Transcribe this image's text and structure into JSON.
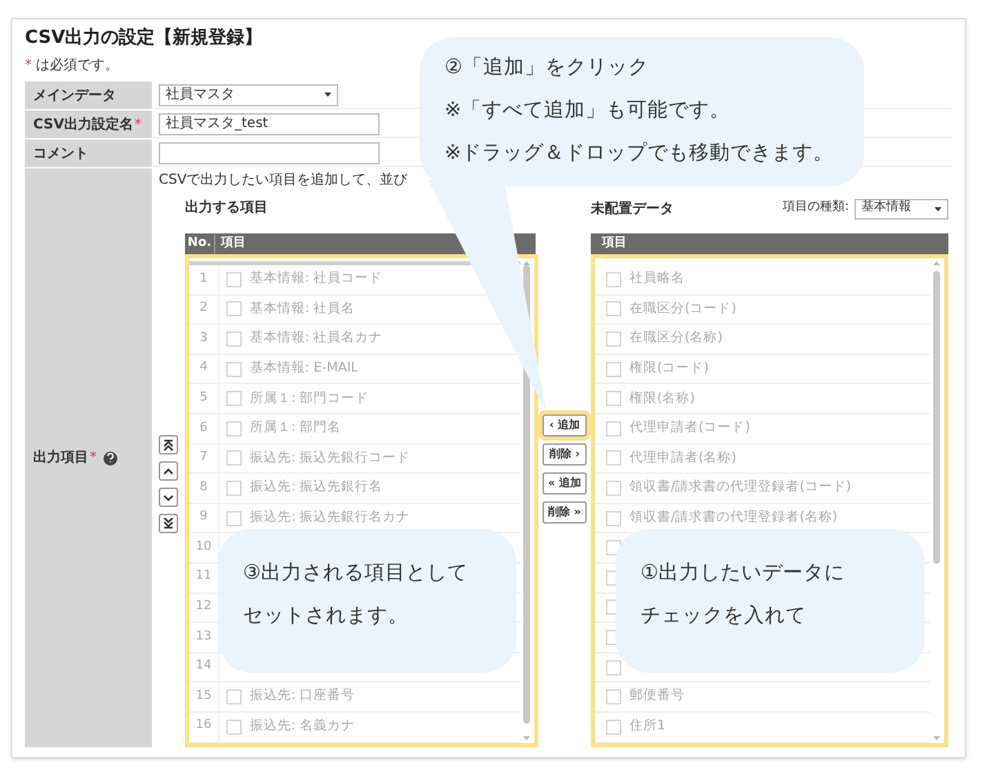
{
  "title": "CSV出力の設定【新規登録】",
  "required_note": {
    "mark": "*",
    "text": "は必須です。"
  },
  "form": [
    {
      "kind": "select",
      "label": "メインデータ",
      "value": "社員マスタ"
    },
    {
      "kind": "text",
      "label": "CSV出力設定名",
      "mark": "*",
      "value": "社員マスタ_test"
    },
    {
      "kind": "text",
      "label": "コメント"
    }
  ],
  "output_items": {
    "label": "出力項目",
    "mark": "*",
    "description": "CSVで出力したい項目を追加して、並び",
    "move_buttons": [
      {
        "kind": "top"
      },
      {
        "kind": "up"
      },
      {
        "kind": "down"
      },
      {
        "kind": "bottom"
      }
    ],
    "selected_list": {
      "title": "出力する項目",
      "columns": [
        "No.",
        "項目"
      ],
      "rows": [
        {
          "no": "1",
          "label": "基本情報: 社員コード",
          "checked": false
        },
        {
          "no": "2",
          "label": "基本情報: 社員名",
          "checked": false
        },
        {
          "no": "3",
          "label": "基本情報: 社員名カナ",
          "checked": false
        },
        {
          "no": "4",
          "label": "基本情報: E-MAIL",
          "checked": false
        },
        {
          "no": "5",
          "label": "所属１: 部門コード",
          "checked": false
        },
        {
          "no": "6",
          "label": "所属１: 部門名",
          "checked": false
        },
        {
          "no": "7",
          "label": "振込先: 振込先銀行コード",
          "checked": false
        },
        {
          "no": "8",
          "label": "振込先: 振込先銀行名",
          "checked": false
        },
        {
          "no": "9",
          "label": "振込先: 振込先銀行名カナ",
          "checked": false
        },
        {
          "no": "10"
        },
        {
          "no": "11"
        },
        {
          "no": "12"
        },
        {
          "no": "13"
        },
        {
          "no": "14"
        },
        {
          "no": "15",
          "label": "振込先: 口座番号",
          "checked": false
        },
        {
          "no": "16",
          "label": "振込先: 名義カナ",
          "checked": false
        }
      ]
    },
    "transfer_buttons": [
      {
        "label": "‹ 追加",
        "highlighted": true
      },
      {
        "label": "削除 ›",
        "highlighted": false
      },
      {
        "label": "« 追加",
        "highlighted": false
      },
      {
        "label": "削除 »",
        "highlighted": false
      }
    ],
    "available_list": {
      "title": "未配置データ",
      "filter_label": "項目の種類:",
      "filter_value": "基本情報",
      "columns": [
        "項目"
      ],
      "rows": [
        {
          "label": "社員略名",
          "checked": false
        },
        {
          "label": "在職区分(コード)",
          "checked": false
        },
        {
          "label": "在職区分(名称)",
          "checked": false
        },
        {
          "label": "権限(コード)",
          "checked": false
        },
        {
          "label": "権限(名称)",
          "checked": false
        },
        {
          "label": "代理申請者(コード)",
          "checked": false
        },
        {
          "label": "代理申請者(名称)",
          "checked": false
        },
        {
          "label": "領収書/請求書の代理登録者(コード)",
          "checked": false
        },
        {
          "label": "領収書/請求書の代理登録者(名称)",
          "checked": false
        },
        {
          "checked": false
        },
        {
          "checked": false
        },
        {
          "checked": false
        },
        {
          "checked": false
        },
        {
          "checked": false
        },
        {
          "label": "郵便番号",
          "checked": false
        },
        {
          "label": "住所1",
          "checked": false
        }
      ]
    }
  },
  "callouts": [
    {
      "kind": "pointer",
      "lines": [
        "②「追加」をクリック",
        "※「すべて追加」も可能です。",
        "※ドラッグ＆ドロップでも移動できます。"
      ]
    },
    {
      "kind": "plain",
      "lines": [
        "③出力される項目として",
        "セットされます。"
      ]
    },
    {
      "kind": "plain",
      "lines": [
        "①出力したいデータに",
        "チェックを入れて"
      ]
    }
  ]
}
